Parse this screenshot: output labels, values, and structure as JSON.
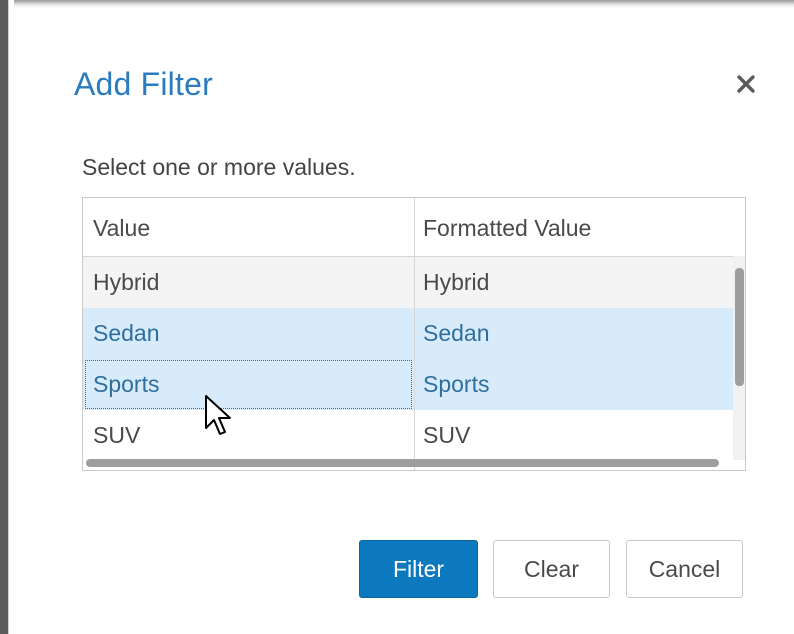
{
  "dialog": {
    "title": "Add Filter",
    "close_icon": "close-icon",
    "subtitle": "Select one or more values."
  },
  "grid": {
    "columns": [
      "Value",
      "Formatted Value"
    ],
    "rows": [
      {
        "value": "Hybrid",
        "formatted": "Hybrid",
        "selected": false
      },
      {
        "value": "Sedan",
        "formatted": "Sedan",
        "selected": true
      },
      {
        "value": "Sports",
        "formatted": "Sports",
        "selected": true,
        "focused": true
      },
      {
        "value": "SUV",
        "formatted": "SUV",
        "selected": false
      }
    ]
  },
  "buttons": {
    "filter": "Filter",
    "clear": "Clear",
    "cancel": "Cancel"
  },
  "colors": {
    "accent": "#0c79bf",
    "title": "#2a7bbf",
    "selection": "#d7ebfa"
  }
}
